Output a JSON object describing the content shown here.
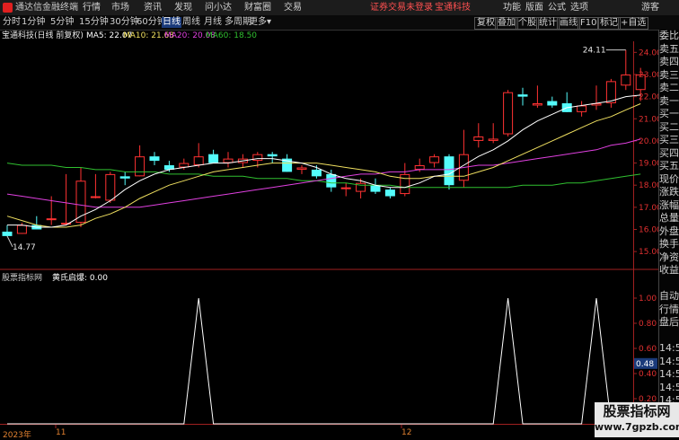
{
  "titlebar": {
    "app_name": "通达信金融终端",
    "menus": [
      "行情",
      "市场",
      "资讯",
      "发现",
      "问小达",
      "财富圈",
      "交易"
    ],
    "notice": "证券交易未登录",
    "stock_name": "宝通科技",
    "right_menus": [
      "功能",
      "版面",
      "公式",
      "选项"
    ],
    "user": "游客"
  },
  "periodbar": {
    "periods": [
      "分时",
      "1分钟",
      "5分钟",
      "15分钟",
      "30分钟",
      "60分钟",
      "日线",
      "周线",
      "月线",
      "多周期",
      "更多"
    ],
    "active": "日线",
    "tools": [
      "复权",
      "叠加",
      "个股",
      "统计",
      "画线",
      "F10",
      "标记",
      "+自选"
    ]
  },
  "mainchart": {
    "title": "宝通科技(日线 前复权)",
    "ma5": "MA5: 22.07",
    "ma10": "MA10: 21.68",
    "ma20": "MA20: 20.08",
    "ma60": "MA60: 18.50",
    "high_label": "24.11",
    "low_label": "14.77",
    "y_ticks": [
      "24.00",
      "23.00",
      "22.00",
      "21.00",
      "20.00",
      "19.00",
      "18.00",
      "17.00",
      "16.00",
      "15.00"
    ]
  },
  "indicator": {
    "title": "股票指标网",
    "name": "黄氏启爆: 0.00",
    "y_ticks": [
      "1.00",
      "0.80",
      "0.60",
      "0.40",
      "0.20",
      "0.00"
    ],
    "cursor_value": "0.48"
  },
  "xaxis": {
    "labels": [
      "2023年",
      "11",
      "12"
    ]
  },
  "rightpanel": {
    "items": [
      "委比",
      "卖五",
      "卖四",
      "卖三",
      "卖二",
      "卖一",
      "买一",
      "买二",
      "买三",
      "买四",
      "买五",
      "现价",
      "涨跌",
      "涨幅",
      "总量",
      "外盘",
      "换手",
      "净资",
      "收益",
      "",
      "自动",
      "行情",
      "盘后",
      "",
      "14:5",
      "14:5",
      "14:5",
      "14:5",
      "14:5",
      "14:5",
      "14:5"
    ]
  },
  "watermark": {
    "line1": "股票指标网",
    "line2": "www.7gpzb.com"
  },
  "colors": {
    "up": "#ff3232",
    "down": "#54fcfc",
    "ma5": "#ffffff",
    "ma10": "#f0e060",
    "ma20": "#e040e0",
    "ma60": "#30c030",
    "indicator": "#ffffff"
  },
  "chart_data": {
    "type": "candlestick",
    "ylim": [
      14.6,
      24.5
    ],
    "candles": [
      {
        "o": 15.9,
        "h": 16.2,
        "l": 15.7,
        "c": 15.7
      },
      {
        "o": 15.8,
        "h": 16.3,
        "l": 15.8,
        "c": 16.2
      },
      {
        "o": 16.2,
        "h": 16.6,
        "l": 16.0,
        "c": 16.0
      },
      {
        "o": 16.5,
        "h": 17.5,
        "l": 16.2,
        "c": 16.5
      },
      {
        "o": 16.3,
        "h": 18.5,
        "l": 16.2,
        "c": 16.3
      },
      {
        "o": 16.3,
        "h": 18.8,
        "l": 16.1,
        "c": 18.2
      },
      {
        "o": 17.5,
        "h": 18.5,
        "l": 17.4,
        "c": 17.5
      },
      {
        "o": 17.3,
        "h": 18.6,
        "l": 17.2,
        "c": 18.5
      },
      {
        "o": 18.4,
        "h": 18.6,
        "l": 18.0,
        "c": 18.3
      },
      {
        "o": 18.4,
        "h": 19.8,
        "l": 18.4,
        "c": 19.3
      },
      {
        "o": 19.3,
        "h": 19.5,
        "l": 18.9,
        "c": 19.1
      },
      {
        "o": 18.9,
        "h": 19.1,
        "l": 18.6,
        "c": 18.7
      },
      {
        "o": 18.8,
        "h": 19.2,
        "l": 18.7,
        "c": 19.0
      },
      {
        "o": 18.9,
        "h": 19.9,
        "l": 18.8,
        "c": 19.3
      },
      {
        "o": 19.4,
        "h": 19.6,
        "l": 19.0,
        "c": 19.0
      },
      {
        "o": 19.0,
        "h": 19.5,
        "l": 18.8,
        "c": 19.2
      },
      {
        "o": 19.0,
        "h": 19.4,
        "l": 18.8,
        "c": 19.2
      },
      {
        "o": 19.1,
        "h": 19.5,
        "l": 18.8,
        "c": 19.4
      },
      {
        "o": 19.4,
        "h": 19.5,
        "l": 19.0,
        "c": 19.3
      },
      {
        "o": 19.2,
        "h": 19.4,
        "l": 18.6,
        "c": 18.6
      },
      {
        "o": 18.7,
        "h": 18.9,
        "l": 18.5,
        "c": 18.8
      },
      {
        "o": 18.7,
        "h": 18.9,
        "l": 18.3,
        "c": 18.4
      },
      {
        "o": 18.5,
        "h": 18.7,
        "l": 17.7,
        "c": 17.9
      },
      {
        "o": 17.9,
        "h": 18.1,
        "l": 17.5,
        "c": 17.9
      },
      {
        "o": 17.7,
        "h": 18.3,
        "l": 17.4,
        "c": 18.1
      },
      {
        "o": 18.0,
        "h": 18.3,
        "l": 17.6,
        "c": 17.7
      },
      {
        "o": 17.8,
        "h": 17.9,
        "l": 17.4,
        "c": 17.5
      },
      {
        "o": 17.6,
        "h": 19.0,
        "l": 17.5,
        "c": 18.5
      },
      {
        "o": 18.7,
        "h": 19.2,
        "l": 18.6,
        "c": 18.9
      },
      {
        "o": 19.0,
        "h": 19.4,
        "l": 18.8,
        "c": 19.3
      },
      {
        "o": 19.3,
        "h": 19.4,
        "l": 17.8,
        "c": 18.0
      },
      {
        "o": 18.2,
        "h": 20.5,
        "l": 17.9,
        "c": 19.4
      },
      {
        "o": 20.0,
        "h": 20.8,
        "l": 19.7,
        "c": 20.2
      },
      {
        "o": 20.0,
        "h": 20.8,
        "l": 19.9,
        "c": 20.1
      },
      {
        "o": 20.3,
        "h": 22.3,
        "l": 20.2,
        "c": 22.2
      },
      {
        "o": 22.1,
        "h": 22.4,
        "l": 21.6,
        "c": 22.0
      },
      {
        "o": 21.6,
        "h": 22.5,
        "l": 21.5,
        "c": 21.7
      },
      {
        "o": 21.8,
        "h": 22.0,
        "l": 21.5,
        "c": 21.6
      },
      {
        "o": 21.7,
        "h": 22.2,
        "l": 21.3,
        "c": 21.3
      },
      {
        "o": 21.3,
        "h": 21.8,
        "l": 21.1,
        "c": 21.6
      },
      {
        "o": 21.6,
        "h": 22.5,
        "l": 21.4,
        "c": 21.7
      },
      {
        "o": 21.7,
        "h": 22.8,
        "l": 21.5,
        "c": 22.7
      },
      {
        "o": 22.5,
        "h": 24.11,
        "l": 22.3,
        "c": 23.0
      },
      {
        "o": 22.3,
        "h": 23.3,
        "l": 21.8,
        "c": 23.0
      }
    ],
    "ma5": [
      16.2,
      16.2,
      16.1,
      16.1,
      16.2,
      16.6,
      16.9,
      17.3,
      17.8,
      18.2,
      18.5,
      18.7,
      18.8,
      18.9,
      19.0,
      19.0,
      19.1,
      19.2,
      19.2,
      19.1,
      19.0,
      18.8,
      18.5,
      18.3,
      18.2,
      18.0,
      17.9,
      17.9,
      18.1,
      18.4,
      18.5,
      18.9,
      19.3,
      19.6,
      20.0,
      20.5,
      20.9,
      21.2,
      21.5,
      21.6,
      21.7,
      21.8,
      22.0,
      22.07
    ],
    "ma10": [
      16.6,
      16.4,
      16.2,
      16.1,
      16.1,
      16.2,
      16.5,
      16.7,
      17.0,
      17.4,
      17.7,
      18.0,
      18.2,
      18.4,
      18.6,
      18.7,
      18.8,
      18.9,
      19.0,
      19.0,
      19.0,
      19.0,
      18.9,
      18.8,
      18.7,
      18.6,
      18.4,
      18.3,
      18.3,
      18.4,
      18.4,
      18.4,
      18.6,
      18.8,
      19.1,
      19.4,
      19.7,
      20.0,
      20.3,
      20.6,
      20.9,
      21.1,
      21.4,
      21.68
    ],
    "ma20": [
      17.6,
      17.5,
      17.4,
      17.3,
      17.2,
      17.1,
      17.0,
      17.0,
      17.0,
      17.0,
      17.1,
      17.2,
      17.3,
      17.4,
      17.5,
      17.6,
      17.7,
      17.8,
      17.9,
      18.0,
      18.1,
      18.2,
      18.3,
      18.4,
      18.5,
      18.5,
      18.6,
      18.6,
      18.7,
      18.7,
      18.7,
      18.8,
      18.9,
      18.9,
      19.0,
      19.1,
      19.2,
      19.3,
      19.4,
      19.5,
      19.6,
      19.8,
      19.9,
      20.08
    ],
    "ma60": [
      19.0,
      18.9,
      18.9,
      18.9,
      18.8,
      18.8,
      18.7,
      18.7,
      18.6,
      18.6,
      18.6,
      18.5,
      18.5,
      18.5,
      18.4,
      18.4,
      18.4,
      18.3,
      18.3,
      18.3,
      18.2,
      18.2,
      18.1,
      18.1,
      18.0,
      18.0,
      18.0,
      17.9,
      17.9,
      17.9,
      17.9,
      17.9,
      17.9,
      17.9,
      17.9,
      18.0,
      18.0,
      18.0,
      18.1,
      18.1,
      18.2,
      18.3,
      18.4,
      18.5
    ],
    "indicator": [
      0,
      0,
      0,
      0,
      0,
      0,
      0,
      0,
      0,
      0,
      0,
      0,
      0,
      1,
      0,
      0,
      0,
      0,
      0,
      0,
      0,
      0,
      0,
      0,
      0,
      0,
      0,
      0,
      0,
      0,
      0,
      0,
      0,
      0,
      1,
      0,
      0,
      0,
      0,
      0,
      1,
      0,
      0,
      0
    ],
    "indicator_ylim": [
      0,
      1.1
    ]
  }
}
